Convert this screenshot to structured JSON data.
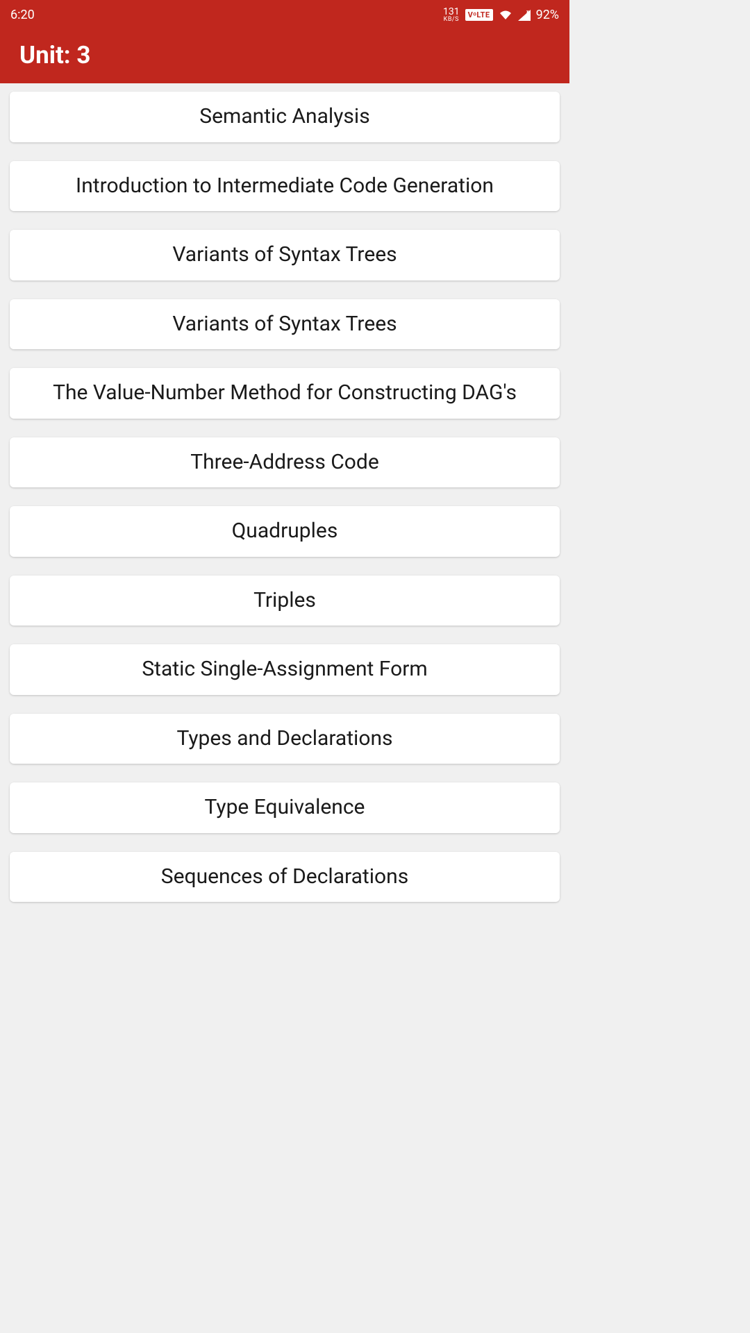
{
  "status_bar": {
    "time": "6:20",
    "data_rate_num": "131",
    "data_rate_unit": "KB/S",
    "volte": "VᵒLTE",
    "battery": "92%"
  },
  "header": {
    "title": "Unit: 3"
  },
  "topics": [
    "Semantic Analysis",
    "Introduction to Intermediate Code Generation",
    "Variants of Syntax Trees",
    "Variants of Syntax Trees",
    "The Value-Number Method for Constructing DAG's",
    "Three-Address Code",
    "Quadruples",
    "Triples",
    "Static Single-Assignment Form",
    "Types and Declarations",
    "Type Equivalence",
    "Sequences of Declarations"
  ]
}
